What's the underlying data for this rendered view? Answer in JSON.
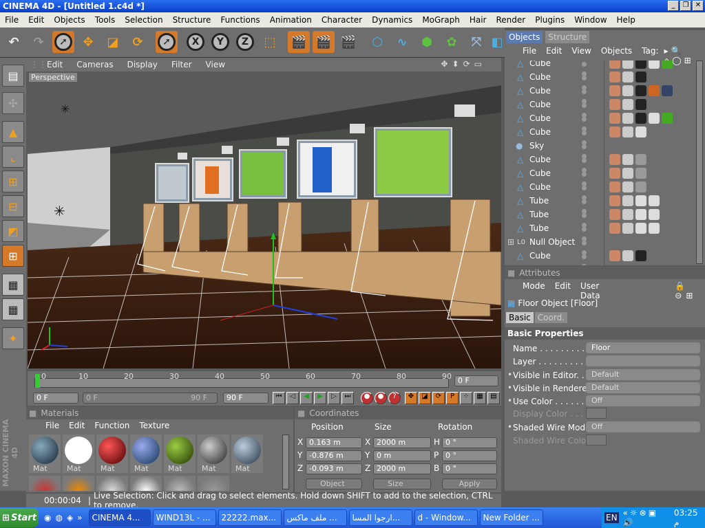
{
  "window": {
    "title": "CINEMA 4D - [Untitled 1.c4d *]"
  },
  "menu": [
    "File",
    "Edit",
    "Objects",
    "Tools",
    "Selection",
    "Structure",
    "Functions",
    "Animation",
    "Character",
    "Dynamics",
    "MoGraph",
    "Hair",
    "Render",
    "Plugins",
    "Window",
    "Help"
  ],
  "viewport": {
    "menu": [
      "Edit",
      "Cameras",
      "Display",
      "Filter",
      "View"
    ],
    "label": "Perspective"
  },
  "timeline": {
    "ticks": [
      "0",
      "10",
      "20",
      "30",
      "40",
      "50",
      "60",
      "70",
      "80",
      "90"
    ],
    "frame": "0 F",
    "start": "0 F",
    "range_start": "0 F",
    "range_end": "90 F",
    "end": "90 F"
  },
  "materials": {
    "title": "Materials",
    "menu": [
      "File",
      "Edit",
      "Function",
      "Texture"
    ],
    "items": [
      "Mat",
      "Mat",
      "Mat",
      "Mat",
      "Mat",
      "Mat",
      "Mat"
    ]
  },
  "coords": {
    "title": "Coordinates",
    "headers": [
      "Position",
      "Size",
      "Rotation"
    ],
    "rows": [
      {
        "axis": "X",
        "pos": "0.163 m",
        "saxis": "X",
        "size": "2000 m",
        "raxis": "H",
        "rot": "0 °"
      },
      {
        "axis": "Y",
        "pos": "-0.876 m",
        "saxis": "Y",
        "size": "0 m",
        "raxis": "P",
        "rot": "0 °"
      },
      {
        "axis": "Z",
        "pos": "-0.093 m",
        "saxis": "Z",
        "size": "2000 m",
        "raxis": "B",
        "rot": "0 °"
      }
    ],
    "mode": "Object",
    "size_mode": "Size",
    "apply": "Apply"
  },
  "status": {
    "time": "00:00:04",
    "message": "Live Selection: Click and drag to select elements. Hold down SHIFT to add to the selection, CTRL to remove."
  },
  "objects": {
    "tabs": [
      "Objects",
      "Structure"
    ],
    "menu": [
      "File",
      "Edit",
      "View",
      "Objects",
      "Tag:"
    ],
    "rows": [
      "Cube",
      "Cube",
      "Cube",
      "Cube",
      "Cube",
      "Cube",
      "Sky",
      "Cube",
      "Cube",
      "Cube",
      "Tube",
      "Tube",
      "Tube",
      "Null Object",
      "Cube"
    ]
  },
  "attributes": {
    "title": "Attributes",
    "menu": [
      "Mode",
      "Edit",
      "User Data"
    ],
    "object": "Floor Object [Floor]",
    "tabs": [
      "Basic",
      "Coord."
    ],
    "section": "Basic Properties",
    "props": [
      {
        "label": "Name . . . . . . . . . . . .",
        "value": "Floor"
      },
      {
        "label": "Layer . . . . . . . . . . . .",
        "value": ""
      },
      {
        "label": "Visible in Editor. . . . .",
        "value": "Default"
      },
      {
        "label": "Visible in Renderer . .",
        "value": "Default"
      },
      {
        "label": "Use Color . . . . . . . .",
        "value": "Off"
      },
      {
        "label": "Display Color . . . .",
        "value": ""
      },
      {
        "label": "Shaded Wire Mode",
        "value": "Off"
      },
      {
        "label": "Shaded Wire Color",
        "value": ""
      }
    ]
  },
  "taskbar": {
    "start": "Start",
    "tasks": [
      "CINEMA 4...",
      "WIND13L - ...",
      "22222.max...",
      "ملف ماكس ...",
      "ارجوا المسا...",
      "d - Window...",
      "New Folder ..."
    ],
    "lang": "EN",
    "clock": "03:25 م"
  },
  "brand": "MAXON CINEMA 4D"
}
